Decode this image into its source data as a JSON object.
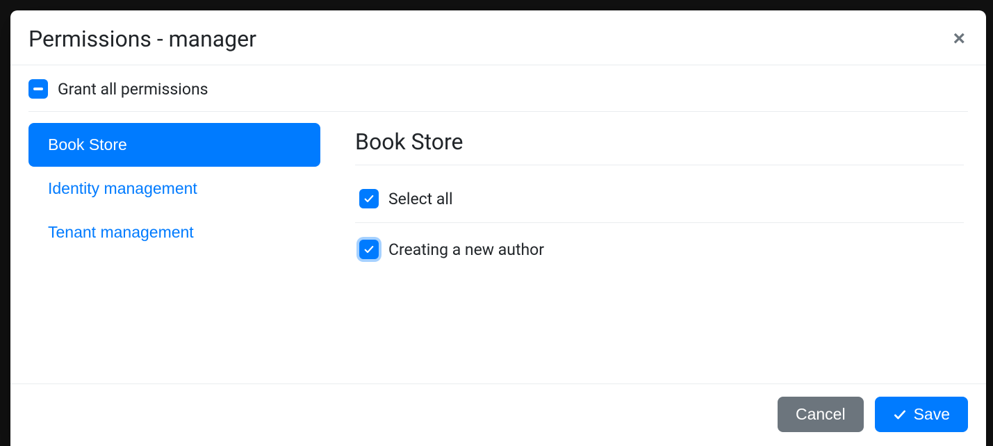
{
  "modal": {
    "title": "Permissions - manager",
    "grant_all_label": "Grant all permissions",
    "grant_all_state": "indeterminate"
  },
  "tabs": {
    "items": [
      {
        "label": "Book Store",
        "active": true
      },
      {
        "label": "Identity management",
        "active": false
      },
      {
        "label": "Tenant management",
        "active": false
      }
    ]
  },
  "panel": {
    "title": "Book Store",
    "select_all_label": "Select all",
    "select_all_checked": true,
    "permissions": [
      {
        "label": "Creating a new author",
        "checked": true,
        "focused": true
      }
    ]
  },
  "footer": {
    "cancel_label": "Cancel",
    "save_label": "Save"
  },
  "colors": {
    "primary": "#007bff",
    "secondary": "#6c757d"
  }
}
